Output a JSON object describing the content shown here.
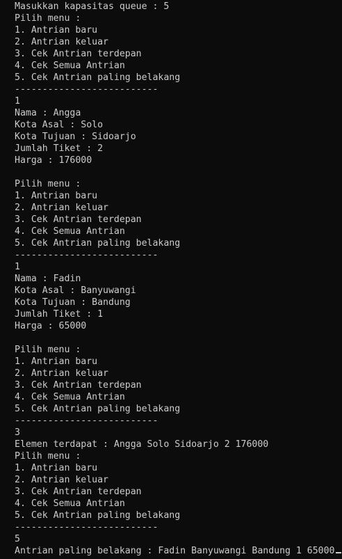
{
  "console": {
    "lines": [
      "Masukkan kapasitas queue : 5",
      "Pilih menu :",
      "1. Antrian baru",
      "2. Antrian keluar",
      "3. Cek Antrian terdepan",
      "4. Cek Semua Antrian",
      "5. Cek Antrian paling belakang",
      "--------------------------",
      "1",
      "Nama : Angga",
      "Kota Asal : Solo",
      "Kota Tujuan : Sidoarjo",
      "Jumlah Tiket : 2",
      "Harga : 176000",
      "",
      "Pilih menu :",
      "1. Antrian baru",
      "2. Antrian keluar",
      "3. Cek Antrian terdepan",
      "4. Cek Semua Antrian",
      "5. Cek Antrian paling belakang",
      "--------------------------",
      "1",
      "Nama : Fadin",
      "Kota Asal : Banyuwangi",
      "Kota Tujuan : Bandung",
      "Jumlah Tiket : 1",
      "Harga : 65000",
      "",
      "Pilih menu :",
      "1. Antrian baru",
      "2. Antrian keluar",
      "3. Cek Antrian terdepan",
      "4. Cek Semua Antrian",
      "5. Cek Antrian paling belakang",
      "--------------------------",
      "3",
      "Elemen terdapat : Angga Solo Sidoarjo 2 176000",
      "Pilih menu :",
      "1. Antrian baru",
      "2. Antrian keluar",
      "3. Cek Antrian terdepan",
      "4. Cek Semua Antrian",
      "5. Cek Antrian paling belakang",
      "--------------------------",
      "5",
      "Antrian paling belakang : Fadin Banyuwangi Bandung 1 65000"
    ],
    "colors": {
      "background": "#0c0c0c",
      "foreground": "#cccccc"
    }
  }
}
